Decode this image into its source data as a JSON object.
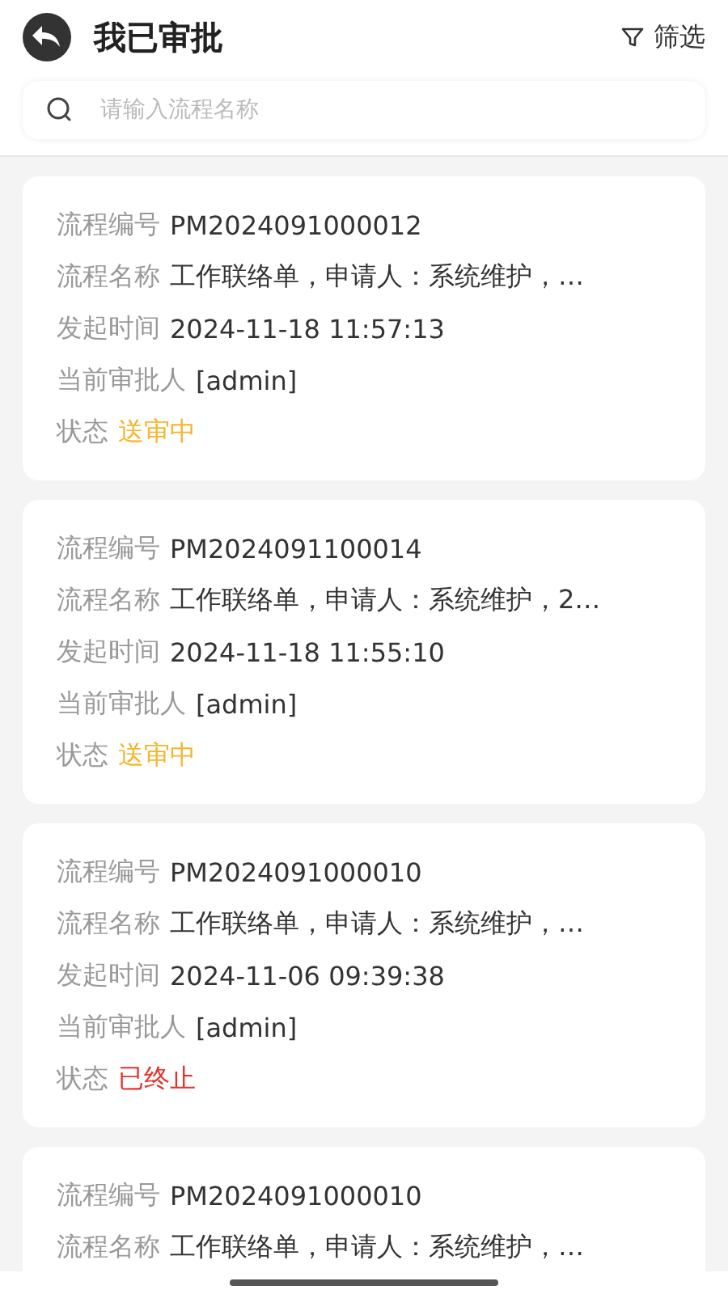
{
  "header": {
    "title": "我已审批",
    "filter_label": "筛选"
  },
  "search": {
    "placeholder": "请输入流程名称"
  },
  "cards": [
    {
      "fields": [
        {
          "label": "流程编号",
          "value": "PM2024091000012"
        },
        {
          "label": "流程名称",
          "value": "工作联络单，申请人：系统维护，…"
        },
        {
          "label": "发起时间",
          "value": "2024-11-18 11:57:13"
        },
        {
          "label": "当前审批人",
          "value": "[admin]"
        }
      ],
      "status": {
        "label": "状态",
        "value": "送审中",
        "kind": "pending"
      }
    },
    {
      "fields": [
        {
          "label": "流程编号",
          "value": "PM2024091100014"
        },
        {
          "label": "流程名称",
          "value": "工作联络单，申请人：系统维护，2…"
        },
        {
          "label": "发起时间",
          "value": "2024-11-18 11:55:10"
        },
        {
          "label": "当前审批人",
          "value": "[admin]"
        }
      ],
      "status": {
        "label": "状态",
        "value": "送审中",
        "kind": "pending"
      }
    },
    {
      "fields": [
        {
          "label": "流程编号",
          "value": "PM2024091000010"
        },
        {
          "label": "流程名称",
          "value": "工作联络单，申请人：系统维护，…"
        },
        {
          "label": "发起时间",
          "value": "2024-11-06 09:39:38"
        },
        {
          "label": "当前审批人",
          "value": "[admin]"
        }
      ],
      "status": {
        "label": "状态",
        "value": "已终止",
        "kind": "terminated"
      }
    },
    {
      "fields": [
        {
          "label": "流程编号",
          "value": "PM2024091000010"
        },
        {
          "label": "流程名称",
          "value": "工作联络单，申请人：系统维护，…"
        }
      ]
    }
  ]
}
